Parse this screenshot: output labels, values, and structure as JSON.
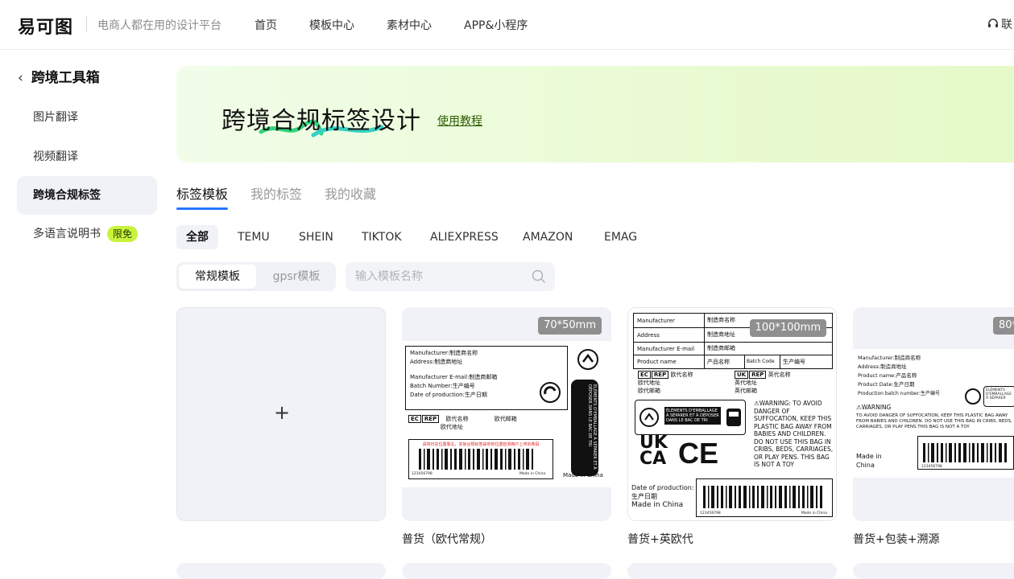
{
  "header": {
    "logo": "易可图",
    "slogan": "电商人都在用的设计平台",
    "nav": [
      "首页",
      "模板中心",
      "素材中心",
      "APP&小程序"
    ],
    "contact": "联"
  },
  "sidebar": {
    "back_label": "跨境工具箱",
    "items": [
      {
        "label": "图片翻译"
      },
      {
        "label": "视频翻译"
      },
      {
        "label": "跨境合规标签"
      },
      {
        "label": "多语言说明书",
        "badge": "限免"
      }
    ]
  },
  "banner": {
    "title": "跨境合规标签设计",
    "link": "使用教程"
  },
  "tabs": [
    "标签模板",
    "我的标签",
    "我的收藏"
  ],
  "filters": [
    "全部",
    "TEMU",
    "SHEIN",
    "TIKTOK",
    "ALIEXPRESS",
    "AMAZON",
    "EMAG"
  ],
  "toggle": [
    "常规模板",
    "gpsr模板"
  ],
  "search": {
    "placeholder": "输入模板名称"
  },
  "cards": [
    {
      "size": "70*50mm",
      "title": "普货（欧代常规）",
      "lines": [
        "Manufacturer:制造商名称",
        "Address:制造商地址",
        "Manufacturer E-mail:制造商邮箱",
        "Batch Number:生产编号",
        "Date of production:生产日期"
      ],
      "ec": "EC",
      "rep": "REP",
      "eu_name": "欧代名称",
      "eu_mail": "欧代邮箱",
      "eu_addr": "欧代地址",
      "warning_strip": "请将日在位置靠左，实际合规标签由你的位置检测用户上传的条码",
      "barcode_num": "123456798",
      "made_in": "Made in China",
      "triman": "ÉLÉMENTS D'EMBALLAGE À SÉPARER ET À DÉPOSER DANS LE BAC DE TRI",
      "made_in_bottom": "Made in China"
    },
    {
      "size": "100*100mm",
      "title": "普货+英欧代",
      "table": [
        [
          "Manufacturer",
          "制造商名称"
        ],
        [
          "Address",
          "制造商地址"
        ],
        [
          "Manufacturer E-mail",
          "制造商邮箱"
        ],
        [
          "Product name",
          "产品名称",
          "Batch Code",
          "生产编号"
        ]
      ],
      "ec": "EC",
      "rep": "REP",
      "uk": "UK",
      "eu_name": "欧代名称",
      "uk_name": "英代名称",
      "eu_addr": "欧代地址",
      "uk_addr": "英代地址",
      "eu_mail": "欧代邮箱",
      "uk_mail": "英代邮箱",
      "fr_text": "ÉLÉMENTS D'EMBALLAGE À SÉPARER ET À DÉPOSER DANS LE BAC DE TRI",
      "warning": "WARNING: TO AVOID DANGER OF SUFFOCATION, KEEP THIS PLASTIC BAG AWAY FROM BABIES AND CHILDREN. DO NOT USE THIS BAG IN CRIBS, BEDS, CARRIAGES, OR PLAY PENS. THIS BAG IS NOT A TOY",
      "ukca": "UK CA",
      "ce": "CE",
      "date_label": "Date of production:",
      "date_value": "生产日期",
      "made_in": "Made in China",
      "barcode_num": "123456798",
      "barcode_made": "Made in China"
    },
    {
      "size": "80*",
      "title": "普货+包装+溯源",
      "lines": [
        "Manufacturer:制造商名称",
        "Address:制造商地址",
        "Product name:产品名称",
        "Product Date:生产日期",
        "Production batch number:生产编号"
      ],
      "warning_head": "WARNING",
      "warning": "TO AVOID DANGER OF SUFFOCATION, KEEP THIS PLASTIC BAG AWAY FROM BABIES AND CHILDREN. DO NOT USE THIS BAG IN CRIBS, BEDS, CARRIAGES, OR PLAY PENS.THIS BAG IS NOT A TOY",
      "made_in": "Made in China",
      "barcode_num": "123456798",
      "fr_text": "ÉLÉMENTS D'EMBALLAGE À SÉPARER"
    }
  ],
  "colors": {
    "accent": "#2776ff",
    "badge": "#c9f33b",
    "banner": "#eafbd4"
  }
}
